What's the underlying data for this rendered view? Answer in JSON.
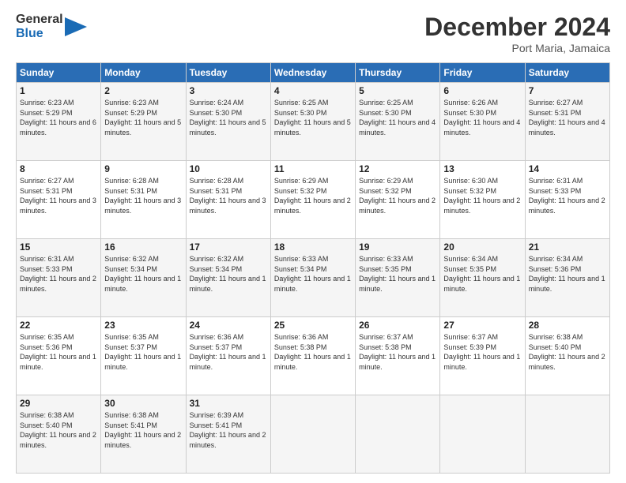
{
  "header": {
    "logo_line1": "General",
    "logo_line2": "Blue",
    "month_title": "December 2024",
    "location": "Port Maria, Jamaica"
  },
  "days_of_week": [
    "Sunday",
    "Monday",
    "Tuesday",
    "Wednesday",
    "Thursday",
    "Friday",
    "Saturday"
  ],
  "weeks": [
    [
      {
        "day": "1",
        "sunrise": "6:23 AM",
        "sunset": "5:29 PM",
        "daylight": "11 hours and 6 minutes."
      },
      {
        "day": "2",
        "sunrise": "6:23 AM",
        "sunset": "5:29 PM",
        "daylight": "11 hours and 5 minutes."
      },
      {
        "day": "3",
        "sunrise": "6:24 AM",
        "sunset": "5:30 PM",
        "daylight": "11 hours and 5 minutes."
      },
      {
        "day": "4",
        "sunrise": "6:25 AM",
        "sunset": "5:30 PM",
        "daylight": "11 hours and 5 minutes."
      },
      {
        "day": "5",
        "sunrise": "6:25 AM",
        "sunset": "5:30 PM",
        "daylight": "11 hours and 4 minutes."
      },
      {
        "day": "6",
        "sunrise": "6:26 AM",
        "sunset": "5:30 PM",
        "daylight": "11 hours and 4 minutes."
      },
      {
        "day": "7",
        "sunrise": "6:27 AM",
        "sunset": "5:31 PM",
        "daylight": "11 hours and 4 minutes."
      }
    ],
    [
      {
        "day": "8",
        "sunrise": "6:27 AM",
        "sunset": "5:31 PM",
        "daylight": "11 hours and 3 minutes."
      },
      {
        "day": "9",
        "sunrise": "6:28 AM",
        "sunset": "5:31 PM",
        "daylight": "11 hours and 3 minutes."
      },
      {
        "day": "10",
        "sunrise": "6:28 AM",
        "sunset": "5:31 PM",
        "daylight": "11 hours and 3 minutes."
      },
      {
        "day": "11",
        "sunrise": "6:29 AM",
        "sunset": "5:32 PM",
        "daylight": "11 hours and 2 minutes."
      },
      {
        "day": "12",
        "sunrise": "6:29 AM",
        "sunset": "5:32 PM",
        "daylight": "11 hours and 2 minutes."
      },
      {
        "day": "13",
        "sunrise": "6:30 AM",
        "sunset": "5:32 PM",
        "daylight": "11 hours and 2 minutes."
      },
      {
        "day": "14",
        "sunrise": "6:31 AM",
        "sunset": "5:33 PM",
        "daylight": "11 hours and 2 minutes."
      }
    ],
    [
      {
        "day": "15",
        "sunrise": "6:31 AM",
        "sunset": "5:33 PM",
        "daylight": "11 hours and 2 minutes."
      },
      {
        "day": "16",
        "sunrise": "6:32 AM",
        "sunset": "5:34 PM",
        "daylight": "11 hours and 1 minute."
      },
      {
        "day": "17",
        "sunrise": "6:32 AM",
        "sunset": "5:34 PM",
        "daylight": "11 hours and 1 minute."
      },
      {
        "day": "18",
        "sunrise": "6:33 AM",
        "sunset": "5:34 PM",
        "daylight": "11 hours and 1 minute."
      },
      {
        "day": "19",
        "sunrise": "6:33 AM",
        "sunset": "5:35 PM",
        "daylight": "11 hours and 1 minute."
      },
      {
        "day": "20",
        "sunrise": "6:34 AM",
        "sunset": "5:35 PM",
        "daylight": "11 hours and 1 minute."
      },
      {
        "day": "21",
        "sunrise": "6:34 AM",
        "sunset": "5:36 PM",
        "daylight": "11 hours and 1 minute."
      }
    ],
    [
      {
        "day": "22",
        "sunrise": "6:35 AM",
        "sunset": "5:36 PM",
        "daylight": "11 hours and 1 minute."
      },
      {
        "day": "23",
        "sunrise": "6:35 AM",
        "sunset": "5:37 PM",
        "daylight": "11 hours and 1 minute."
      },
      {
        "day": "24",
        "sunrise": "6:36 AM",
        "sunset": "5:37 PM",
        "daylight": "11 hours and 1 minute."
      },
      {
        "day": "25",
        "sunrise": "6:36 AM",
        "sunset": "5:38 PM",
        "daylight": "11 hours and 1 minute."
      },
      {
        "day": "26",
        "sunrise": "6:37 AM",
        "sunset": "5:38 PM",
        "daylight": "11 hours and 1 minute."
      },
      {
        "day": "27",
        "sunrise": "6:37 AM",
        "sunset": "5:39 PM",
        "daylight": "11 hours and 1 minute."
      },
      {
        "day": "28",
        "sunrise": "6:38 AM",
        "sunset": "5:40 PM",
        "daylight": "11 hours and 2 minutes."
      }
    ],
    [
      {
        "day": "29",
        "sunrise": "6:38 AM",
        "sunset": "5:40 PM",
        "daylight": "11 hours and 2 minutes."
      },
      {
        "day": "30",
        "sunrise": "6:38 AM",
        "sunset": "5:41 PM",
        "daylight": "11 hours and 2 minutes."
      },
      {
        "day": "31",
        "sunrise": "6:39 AM",
        "sunset": "5:41 PM",
        "daylight": "11 hours and 2 minutes."
      },
      {
        "day": "",
        "sunrise": "",
        "sunset": "",
        "daylight": ""
      },
      {
        "day": "",
        "sunrise": "",
        "sunset": "",
        "daylight": ""
      },
      {
        "day": "",
        "sunrise": "",
        "sunset": "",
        "daylight": ""
      },
      {
        "day": "",
        "sunrise": "",
        "sunset": "",
        "daylight": ""
      }
    ]
  ]
}
